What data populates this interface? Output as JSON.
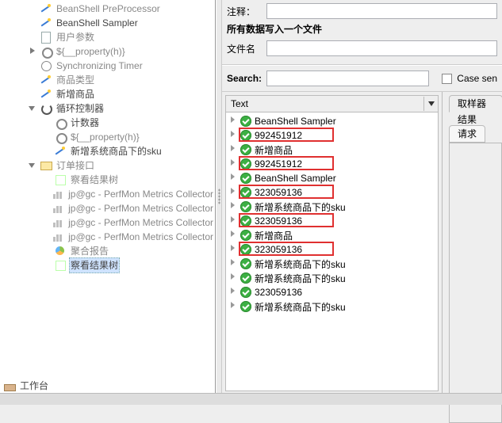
{
  "tree": {
    "items": [
      {
        "label": "BeanShell PreProcessor",
        "disabled": true,
        "indent": 2,
        "icon": "req"
      },
      {
        "label": "BeanShell Sampler",
        "disabled": false,
        "indent": 2,
        "icon": "req"
      },
      {
        "label": "用户参数",
        "disabled": true,
        "indent": 2,
        "icon": "doc"
      },
      {
        "label": "${__property(h)}",
        "disabled": true,
        "indent": 2,
        "icon": "gear",
        "toggle": "closed"
      },
      {
        "label": "Synchronizing Timer",
        "disabled": true,
        "indent": 2,
        "icon": "clock"
      },
      {
        "label": "商品类型",
        "disabled": true,
        "indent": 2,
        "icon": "req"
      },
      {
        "label": "新增商品",
        "disabled": false,
        "indent": 2,
        "icon": "req"
      },
      {
        "label": "循环控制器",
        "disabled": false,
        "indent": 2,
        "icon": "loop",
        "toggle": "open"
      },
      {
        "label": "计数器",
        "disabled": false,
        "indent": 3,
        "icon": "gear"
      },
      {
        "label": "${__property(h)}",
        "disabled": true,
        "indent": 3,
        "icon": "gear"
      },
      {
        "label": "新增系统商品下的sku",
        "disabled": false,
        "indent": 3,
        "icon": "req"
      },
      {
        "label": "订单接口",
        "disabled": true,
        "indent": 2,
        "icon": "folder",
        "toggle": "open"
      },
      {
        "label": "察看结果树",
        "disabled": true,
        "indent": 3,
        "icon": "tree"
      },
      {
        "label": "jp@gc - PerfMon Metrics Collector",
        "disabled": true,
        "indent": 3,
        "icon": "bar"
      },
      {
        "label": "jp@gc - PerfMon Metrics Collector",
        "disabled": true,
        "indent": 3,
        "icon": "bar"
      },
      {
        "label": "jp@gc - PerfMon Metrics Collector",
        "disabled": true,
        "indent": 3,
        "icon": "bar"
      },
      {
        "label": "jp@gc - PerfMon Metrics Collector",
        "disabled": true,
        "indent": 3,
        "icon": "bar"
      },
      {
        "label": "聚合报告",
        "disabled": true,
        "indent": 3,
        "icon": "pie"
      },
      {
        "label": "察看结果树",
        "disabled": false,
        "indent": 3,
        "icon": "tree",
        "selected": true
      }
    ],
    "workbench": "工作台"
  },
  "form": {
    "comment_label": "注释：",
    "section_title": "所有数据写入一个文件",
    "filename_label": "文件名"
  },
  "search": {
    "label": "Search:",
    "value": "",
    "case_label": "Case sen"
  },
  "results": {
    "header": "Text",
    "items": [
      {
        "label": "BeanShell Sampler"
      },
      {
        "label": "992451912",
        "hl": true
      },
      {
        "label": "新增商品"
      },
      {
        "label": "992451912",
        "hl": true
      },
      {
        "label": "BeanShell Sampler"
      },
      {
        "label": "323059136",
        "hl": true
      },
      {
        "label": "新增系统商品下的sku"
      },
      {
        "label": "323059136",
        "hl": true
      },
      {
        "label": "新增商品"
      },
      {
        "label": "323059136",
        "hl": true
      },
      {
        "label": "新增系统商品下的sku"
      },
      {
        "label": "新增系统商品下的sku"
      },
      {
        "label": "323059136"
      },
      {
        "label": "新增系统商品下的sku"
      }
    ]
  },
  "tabs": {
    "t1": "取样器结果",
    "t2": "请求"
  }
}
